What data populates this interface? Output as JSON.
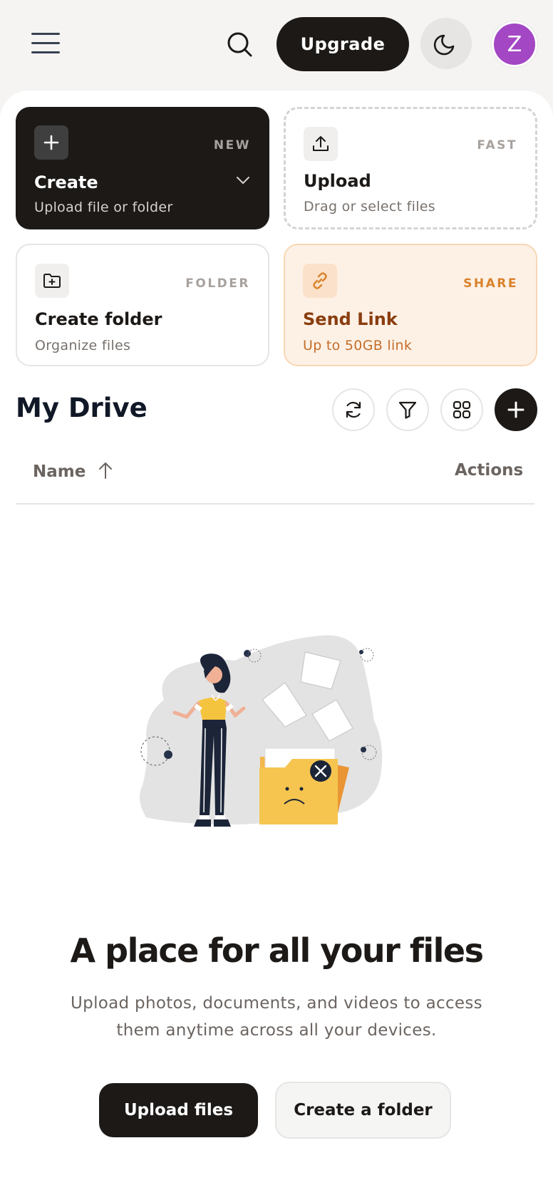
{
  "header": {
    "menu_icon": "hamburger-icon",
    "search_icon": "search-icon",
    "upgrade_label": "Upgrade",
    "theme_icon": "moon-icon",
    "avatar_initial": "Z",
    "avatar_color": "#a347c4"
  },
  "cards": {
    "create": {
      "title": "Create",
      "subtitle": "Upload file or folder",
      "tag": "NEW",
      "icon": "plus-icon"
    },
    "upload": {
      "title": "Upload",
      "subtitle": "Drag or select files",
      "tag": "FAST",
      "icon": "upload-icon"
    },
    "folder": {
      "title": "Create folder",
      "subtitle": "Organize files",
      "tag": "FOLDER",
      "icon": "folder-plus-icon"
    },
    "link": {
      "title": "Send Link",
      "subtitle": "Up to 50GB link",
      "tag": "SHARE",
      "icon": "link-icon",
      "accent": "#d9822b"
    }
  },
  "drive": {
    "title": "My Drive",
    "toolbar_icons": [
      "refresh-icon",
      "filter-icon",
      "grid-icon",
      "plus-icon"
    ],
    "columns": {
      "name": "Name",
      "actions": "Actions"
    },
    "sort": "ascending"
  },
  "empty_state": {
    "title": "A place for all your files",
    "text": "Upload photos, documents, and videos to access them anytime across all your devices.",
    "upload_label": "Upload files",
    "folder_label": "Create a folder"
  }
}
